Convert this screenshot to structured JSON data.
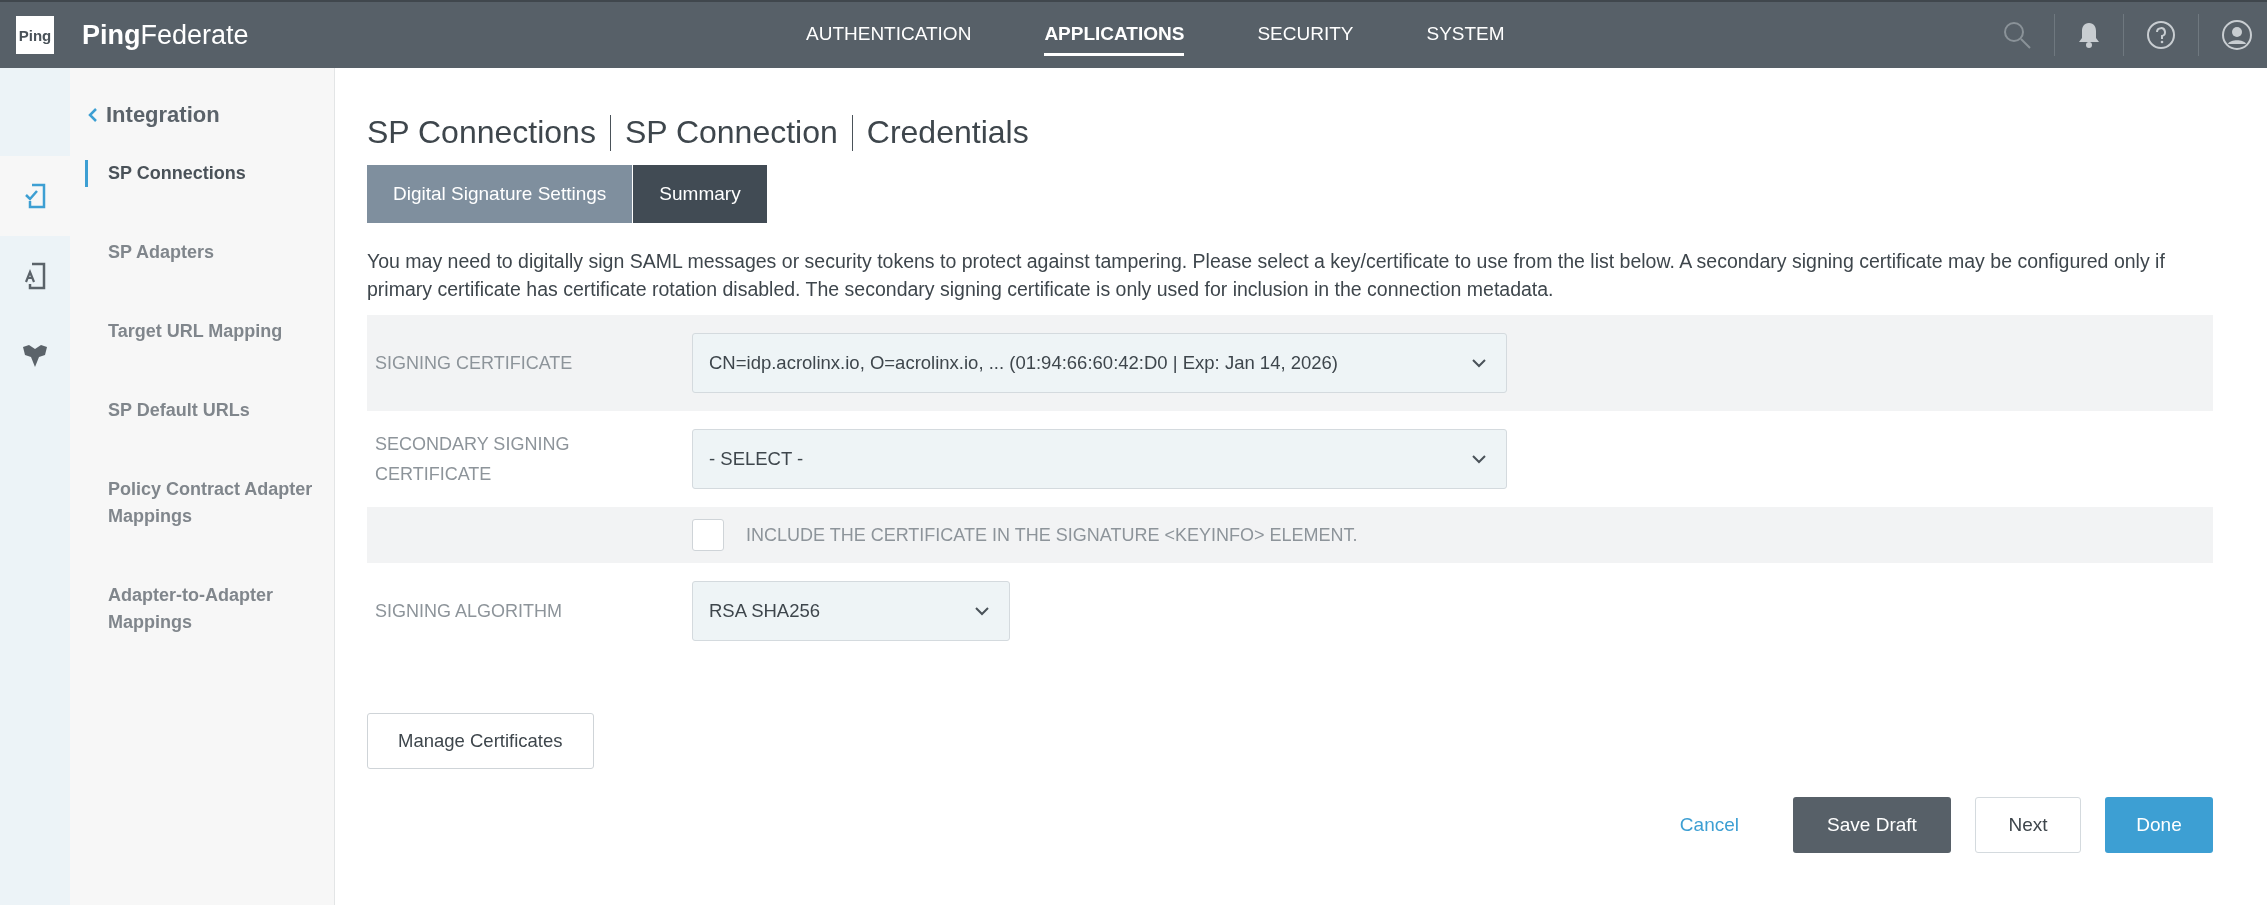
{
  "header": {
    "logo_text": "Ping",
    "product": "**Ping**Federate",
    "nav": [
      {
        "label": "AUTHENTICATION",
        "selected": false
      },
      {
        "label": "APPLICATIONS",
        "selected": true
      },
      {
        "label": "SECURITY",
        "selected": false
      },
      {
        "label": "SYSTEM",
        "selected": false
      }
    ]
  },
  "rail": [
    {
      "kind": "connection",
      "selected": true
    },
    {
      "kind": "adapter",
      "selected": false
    },
    {
      "kind": "mapping",
      "selected": false
    }
  ],
  "sidebar": {
    "back_label": "Integration",
    "items": [
      {
        "label": "SP Connections",
        "selected": true
      },
      {
        "label": "SP Adapters",
        "selected": false
      },
      {
        "label": "Target URL Mapping",
        "selected": false
      },
      {
        "label": "SP Default URLs",
        "selected": false
      },
      {
        "label": "Policy Contract Adapter Mappings",
        "selected": false
      },
      {
        "label": "Adapter-to-Adapter Mappings",
        "selected": false
      }
    ]
  },
  "breadcrumb": [
    "SP Connections",
    "SP Connection",
    "Credentials"
  ],
  "tabs": [
    {
      "label": "Digital Signature Settings",
      "selected": false
    },
    {
      "label": "Summary",
      "selected": true
    }
  ],
  "description": "You may need to digitally sign SAML messages or security tokens to protect against tampering. Please select a key/certificate to use from the list below. A secondary signing certificate may be configured only if primary certificate has certificate rotation disabled. The secondary signing certificate is only used for inclusion in the connection metadata.",
  "form": [
    {
      "kind": "select",
      "label": "SIGNING CERTIFICATE",
      "value": "CN=idp.acrolinx.io, O=acrolinx.io, ... (01:94:66:60:42:D0 | Exp: Jan 14, 2026)",
      "shaded": true
    },
    {
      "kind": "select",
      "label": "SECONDARY SIGNING CERTIFICATE",
      "value": "- SELECT -",
      "shaded": false
    },
    {
      "kind": "checkbox",
      "label": "INCLUDE THE CERTIFICATE IN THE SIGNATURE <KEYINFO> ELEMENT.",
      "checked": false,
      "shaded": true
    },
    {
      "kind": "short_select",
      "label": "SIGNING ALGORITHM",
      "value": "RSA SHA256",
      "shaded": false
    }
  ],
  "manage_button": "Manage Certificates",
  "footer": {
    "cancel": "Cancel",
    "save_draft": "Save Draft",
    "next": "Next",
    "done": "Done"
  }
}
